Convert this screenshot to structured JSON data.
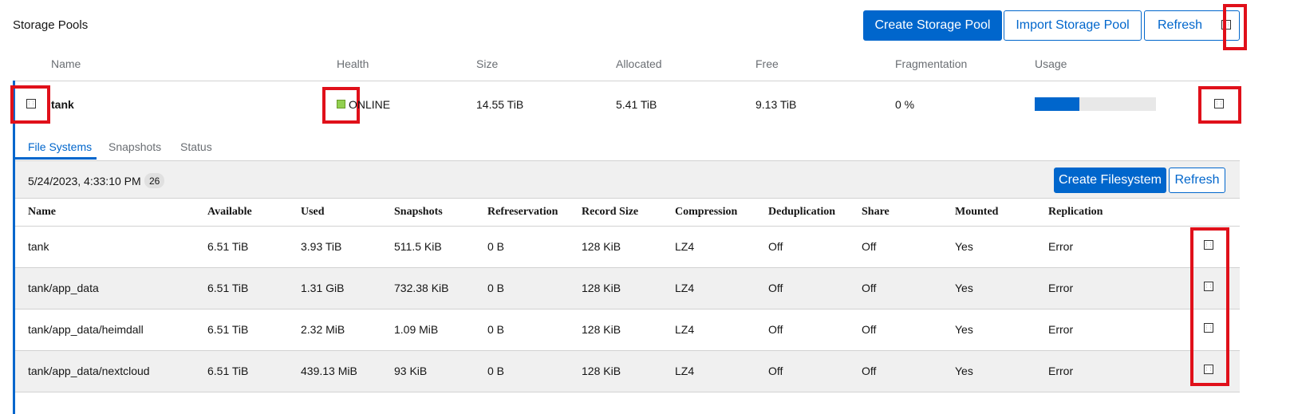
{
  "header": {
    "title": "Storage Pools",
    "create_pool_label": "Create Storage Pool",
    "import_pool_label": "Import Storage Pool",
    "refresh_label": "Refresh"
  },
  "pool_table": {
    "columns": [
      "Name",
      "Health",
      "Size",
      "Allocated",
      "Free",
      "Fragmentation",
      "Usage"
    ]
  },
  "pool": {
    "name": "tank",
    "health": "ONLINE",
    "size": "14.55 TiB",
    "allocated": "5.41 TiB",
    "free": "9.13 TiB",
    "fragmentation": "0 %",
    "usage_fraction": 0.37
  },
  "tabs": [
    "File Systems",
    "Snapshots",
    "Status"
  ],
  "fs_toolbar": {
    "timestamp": "5/24/2023, 4:33:10 PM",
    "count": "26",
    "create_label": "Create Filesystem",
    "refresh_label": "Refresh"
  },
  "fs_table": {
    "columns": [
      "Name",
      "Available",
      "Used",
      "Snapshots",
      "Refreservation",
      "Record Size",
      "Compression",
      "Deduplication",
      "Share",
      "Mounted",
      "Replication"
    ],
    "rows": [
      [
        "tank",
        "6.51 TiB",
        "3.93 TiB",
        "511.5 KiB",
        "0 B",
        "128 KiB",
        "LZ4",
        "Off",
        "Off",
        "Yes",
        "Error"
      ],
      [
        "tank/app_data",
        "6.51 TiB",
        "1.31 GiB",
        "732.38 KiB",
        "0 B",
        "128 KiB",
        "LZ4",
        "Off",
        "Off",
        "Yes",
        "Error"
      ],
      [
        "tank/app_data/heimdall",
        "6.51 TiB",
        "2.32 MiB",
        "1.09 MiB",
        "0 B",
        "128 KiB",
        "LZ4",
        "Off",
        "Off",
        "Yes",
        "Error"
      ],
      [
        "tank/app_data/nextcloud",
        "6.51 TiB",
        "439.13 MiB",
        "93 KiB",
        "0 B",
        "128 KiB",
        "LZ4",
        "Off",
        "Off",
        "Yes",
        "Error"
      ]
    ]
  },
  "icons": {
    "kebab": "kebab-menu-icon",
    "expand": "expand-toggle-icon",
    "health": "health-status-icon"
  },
  "colors": {
    "accent": "#0066cc",
    "highlight": "#e0101a",
    "health_ok": "#92d050"
  }
}
